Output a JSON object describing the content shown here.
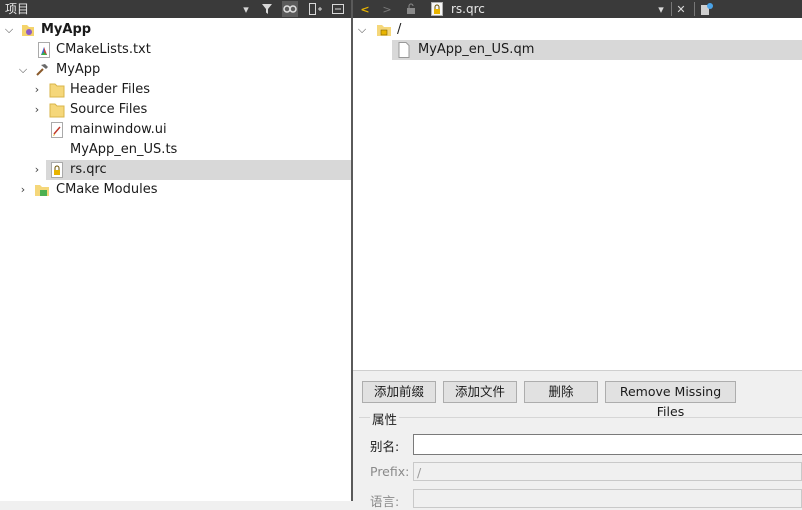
{
  "left_toolbar": {
    "title": "项目"
  },
  "right_toolbar": {
    "file_name": "rs.qrc"
  },
  "tree": [
    {
      "label": "MyApp",
      "bold": true
    },
    {
      "label": "CMakeLists.txt"
    },
    {
      "label": "MyApp"
    },
    {
      "label": "Header Files"
    },
    {
      "label": "Source Files"
    },
    {
      "label": "mainwindow.ui"
    },
    {
      "label": "MyApp_en_US.ts"
    },
    {
      "label": "rs.qrc",
      "selected": true
    },
    {
      "label": "CMake Modules"
    }
  ],
  "resource_tree": {
    "prefix": "/",
    "file": "MyApp_en_US.qm"
  },
  "buttons": {
    "add_prefix": "添加前缀",
    "add_files": "添加文件",
    "remove": "删除",
    "remove_missing": "Remove Missing Files"
  },
  "properties": {
    "title": "属性",
    "alias_label": "别名:",
    "alias_value": "",
    "prefix_label": "Prefix:",
    "prefix_value": "/",
    "language_label": "语言:"
  },
  "colors": {
    "toolbar_bg": "#3a3a3a",
    "selection_bg": "#d8d8d8",
    "accent_yellow": "#e8b400"
  }
}
